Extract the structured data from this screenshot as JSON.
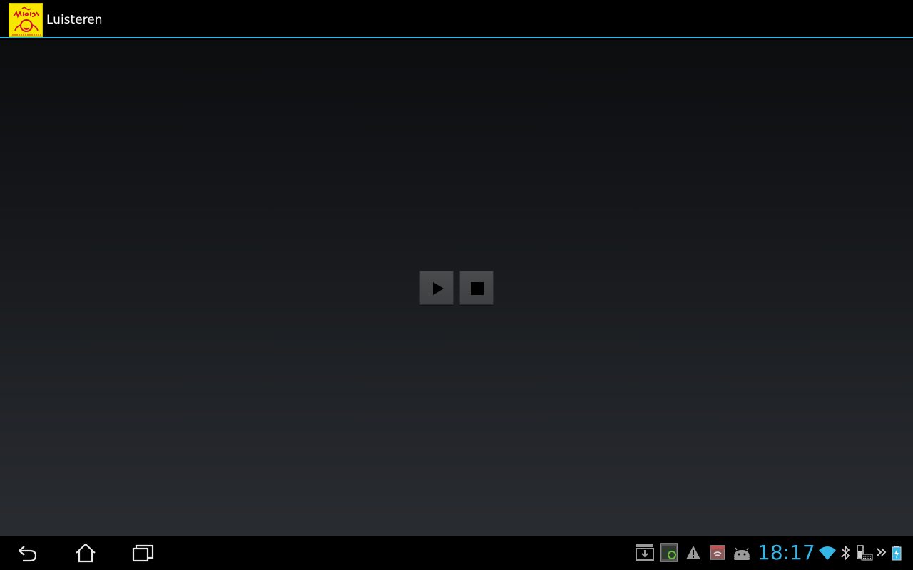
{
  "action_bar": {
    "title": "Luisteren",
    "app_icon": "radio-zwetsoaks-logo-icon"
  },
  "player": {
    "play_icon": "play-icon",
    "stop_icon": "stop-icon"
  },
  "navigation": {
    "back_icon": "back-icon",
    "home_icon": "home-icon",
    "recents_icon": "recent-apps-icon"
  },
  "notifications": [
    {
      "icon": "download-icon"
    },
    {
      "icon": "screenshot-icon"
    },
    {
      "icon": "warning-icon"
    },
    {
      "icon": "wifi-calendar-icon"
    },
    {
      "icon": "android-icon"
    }
  ],
  "status": {
    "time": "18:17",
    "wifi_icon": "wifi-icon",
    "bluetooth_icon": "bluetooth-icon",
    "keyboard_icon": "keyboard-battery-icon",
    "more_icon": "chevron-right-icon",
    "battery_icon": "battery-charging-icon"
  },
  "colors": {
    "accent": "#33b5e5",
    "logo_yellow": "#f6e600",
    "logo_red": "#d3102a"
  }
}
